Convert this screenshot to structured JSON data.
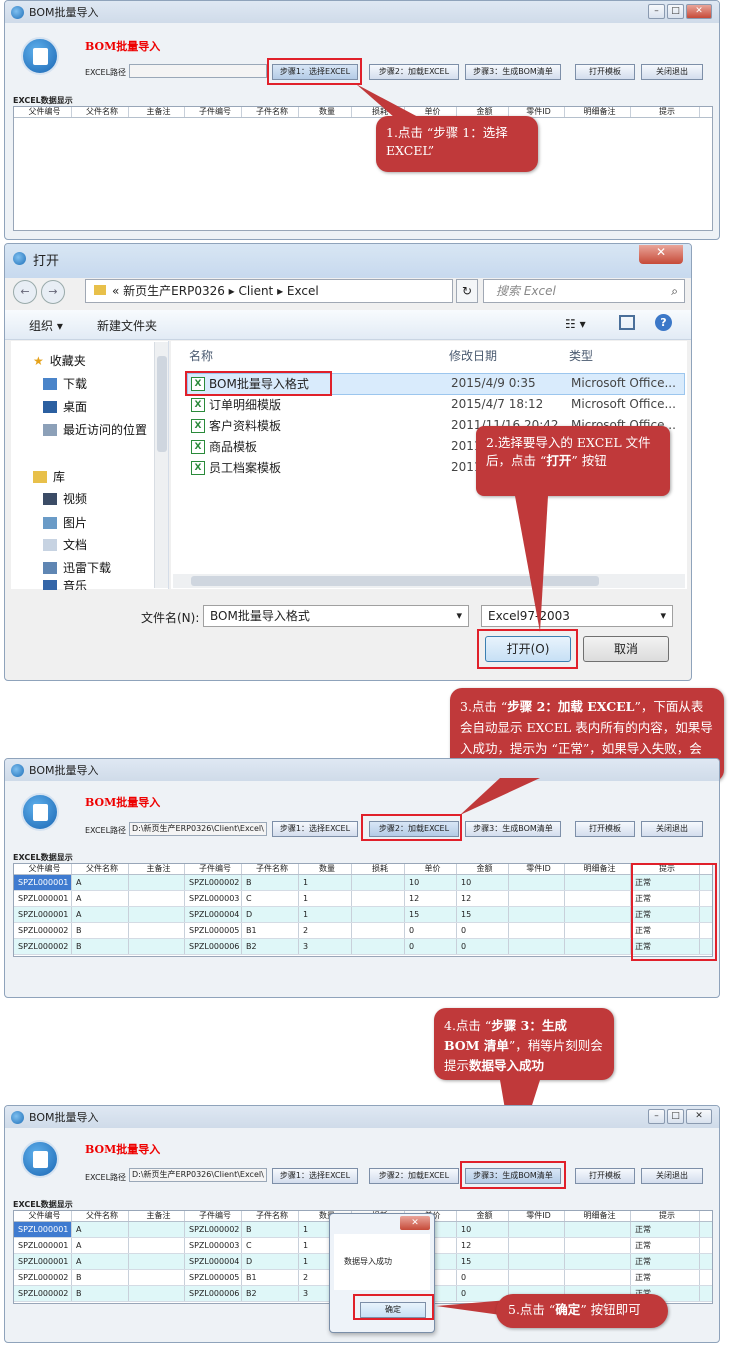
{
  "app": {
    "window_title": "BOM批量导入",
    "header": "BOM批量导入",
    "path_label": "EXCEL路径",
    "path_value": "D:\\新页生产ERP0326\\Client\\Excel\\",
    "buttons": {
      "step1": "步骤1：选择EXCEL",
      "step2": "步骤2：加载EXCEL",
      "step3": "步骤3：生成BOM清单",
      "open_template": "打开模板",
      "close_exit": "关闭退出"
    },
    "grid_label": "EXCEL数据显示",
    "columns": [
      "父件编号",
      "父件名称",
      "主备注",
      "子件编号",
      "子件名称",
      "数量",
      "损耗",
      "单价",
      "金额",
      "零件ID",
      "明细备注",
      "提示"
    ],
    "rows": [
      [
        "SPZL000001",
        "A",
        "",
        "SPZL000002",
        "B",
        "1",
        "",
        "10",
        "10",
        "",
        "",
        "正常"
      ],
      [
        "SPZL000001",
        "A",
        "",
        "SPZL000003",
        "C",
        "1",
        "",
        "12",
        "12",
        "",
        "",
        "正常"
      ],
      [
        "SPZL000001",
        "A",
        "",
        "SPZL000004",
        "D",
        "1",
        "",
        "15",
        "15",
        "",
        "",
        "正常"
      ],
      [
        "SPZL000002",
        "B",
        "",
        "SPZL000005",
        "B1",
        "2",
        "",
        "0",
        "0",
        "",
        "",
        "正常"
      ],
      [
        "SPZL000002",
        "B",
        "",
        "SPZL000006",
        "B2",
        "3",
        "",
        "0",
        "0",
        "",
        "",
        "正常"
      ]
    ]
  },
  "dialog": {
    "title": "打开",
    "breadcrumb": [
      "新页生产ERP0326",
      "Client",
      "Excel"
    ],
    "search_placeholder": "搜索 Excel",
    "organize": "组织 ▾",
    "new_folder": "新建文件夹",
    "nav": [
      "收藏夹",
      "下载",
      "桌面",
      "最近访问的位置",
      "库",
      "视频",
      "图片",
      "文档",
      "迅雷下载",
      "音乐"
    ],
    "col_name": "名称",
    "col_date": "修改日期",
    "col_type": "类型",
    "files": [
      {
        "name": "BOM批量导入格式",
        "date": "2015/4/9 0:35",
        "type": "Microsoft Office..."
      },
      {
        "name": "订单明细模版",
        "date": "2015/4/7 18:12",
        "type": "Microsoft Office..."
      },
      {
        "name": "客户资料模板",
        "date": "2011/11/16 20:42",
        "type": "Microsoft Office..."
      },
      {
        "name": "商品模板",
        "date": "2011",
        "type": ""
      },
      {
        "name": "员工档案模板",
        "date": "2011",
        "type": ""
      }
    ],
    "filename_label": "文件名(N):",
    "filename_value": "BOM批量导入格式",
    "filetype_value": "Excel97-2003",
    "open_btn": "打开(O)",
    "cancel_btn": "取消"
  },
  "msgbox": {
    "text": "数据导入成功",
    "ok": "确定"
  },
  "callouts": {
    "c1": "1.点击 “步骤 1：选择 EXCEL”",
    "c2a": "2.选择要导入的 EXCEL 文件后，点击 “",
    "c2b": "打开",
    "c2c": "” 按钮",
    "c3a": "3.点击 “",
    "c3b": "步骤 2：加载 EXCEL",
    "c3c": "”，下面从表会自动显示 EXCEL 表内所有的内容，如果导入成功，提示为 “正常”，如果导入失败，会显示失败的原因",
    "c4a": "4.点击 “",
    "c4b": "步骤 3：生成 BOM 清单",
    "c4c": "”，稍等片刻则会提示",
    "c4d": "数据导入成功",
    "c5a": "5.点击 “",
    "c5b": "确定",
    "c5c": "” 按钮即可"
  }
}
